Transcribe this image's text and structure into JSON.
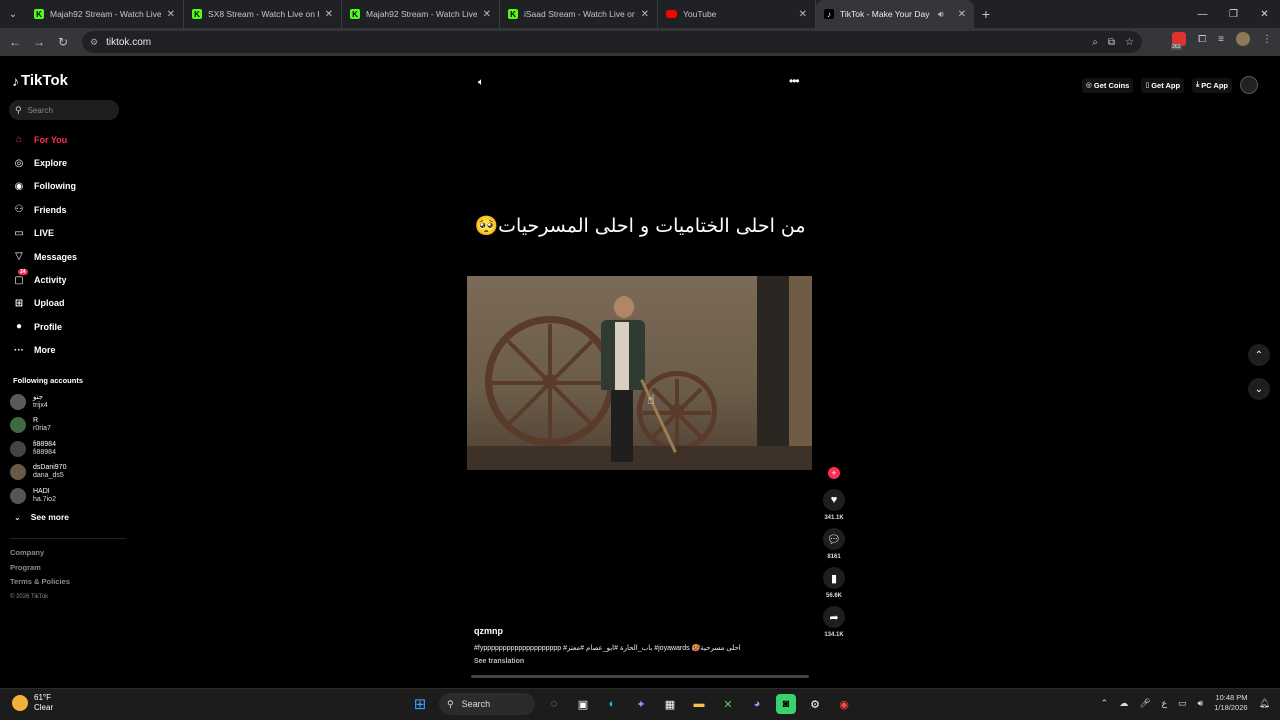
{
  "browser": {
    "tabs": [
      {
        "title": "Majah92 Stream - Watch Live o",
        "icon": "kick-icon",
        "active": false
      },
      {
        "title": "SX8 Stream - Watch Live on Ki",
        "icon": "kick-icon",
        "active": false
      },
      {
        "title": "Majah92 Stream - Watch Live o",
        "icon": "kick-icon",
        "active": false
      },
      {
        "title": "iSaad Stream - Watch Live on I",
        "icon": "kick-icon",
        "active": false
      },
      {
        "title": "YouTube",
        "icon": "youtube-icon",
        "active": false
      },
      {
        "title": "TikTok - Make Your Day",
        "icon": "tiktok-icon",
        "active": true
      }
    ],
    "url": "tiktok.com",
    "extension_badge": "263"
  },
  "tiktok": {
    "logo_text": "TikTok",
    "search_placeholder": "Search",
    "nav": [
      {
        "label": "For You",
        "icon": "home-icon",
        "active": true
      },
      {
        "label": "Explore",
        "icon": "compass-icon"
      },
      {
        "label": "Following",
        "icon": "following-icon"
      },
      {
        "label": "Friends",
        "icon": "friends-icon"
      },
      {
        "label": "LIVE",
        "icon": "live-icon"
      },
      {
        "label": "Messages",
        "icon": "messages-icon"
      },
      {
        "label": "Activity",
        "icon": "activity-icon",
        "badge": "24"
      },
      {
        "label": "Upload",
        "icon": "upload-icon"
      },
      {
        "label": "Profile",
        "icon": "profile-icon"
      },
      {
        "label": "More",
        "icon": "more-icon"
      }
    ],
    "following_title": "Following accounts",
    "following_accounts": [
      {
        "name": "جنو",
        "handle": "trijx4"
      },
      {
        "name": "R",
        "handle": "r0ria7"
      },
      {
        "name": "fi88984",
        "handle": "fi88984"
      },
      {
        "name": "dsDani970",
        "handle": "dana_ds5"
      },
      {
        "name": "HADI",
        "handle": "ha.7io2"
      }
    ],
    "see_more": "See more",
    "footer": {
      "links": [
        "Company",
        "Program",
        "Terms & Policies"
      ],
      "copyright": "© 2026 TikTok"
    },
    "top_links": {
      "coins": "Get Coins",
      "app": "Get App",
      "pc": "PC App"
    },
    "video": {
      "caption": "من احلى الختاميات و احلى المسرحيات🥺",
      "author": "qzmnp",
      "description": "#fypppppppppppppppppppp #باب_الحارة #ابو_عصام #معتز #joyawards 🥵احلى مسرحية",
      "see_translation": "See translation",
      "likes": "341.1K",
      "comments": "8161",
      "saves": "56.6K",
      "shares": "134.1K",
      "progress": 0.0
    }
  },
  "taskbar": {
    "weather_temp": "61°F",
    "weather_desc": "Clear",
    "search_label": "Search",
    "time": "10:48 PM",
    "date": "1/18/2026"
  },
  "colors": {
    "accent": "#fe2c55",
    "chrome_bg": "#202124",
    "page_bg": "#000000"
  }
}
